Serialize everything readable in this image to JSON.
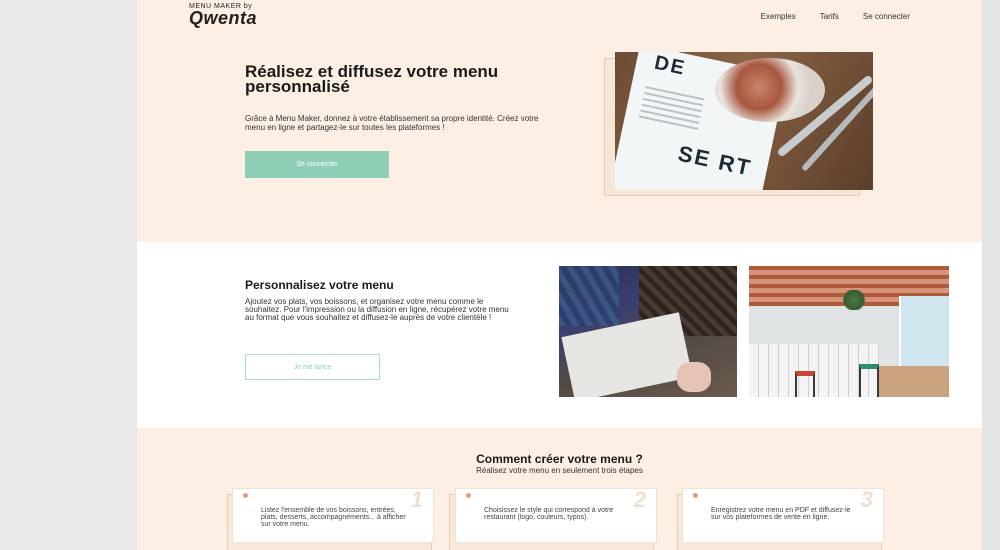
{
  "header": {
    "logo_small": "MENU MAKER by",
    "logo_big": "Qwenta",
    "nav": [
      "Exemples",
      "Tarifs",
      "Se connecter"
    ]
  },
  "hero": {
    "title": "Réalisez et diffusez votre menu personnalisé",
    "text": "Grâce à Menu Maker, donnez à votre établissement sa propre identité. Créez votre menu en ligne et partagez-le sur toutes les plateformes !",
    "button": "Se connecter",
    "photo_text_top": "DE",
    "photo_text_bottom": "SE RT"
  },
  "section2": {
    "title": "Personnalisez votre menu",
    "text": "Ajoutez vos plats, vos boissons, et organisez votre menu comme le souhaitez. Pour l'impression ou la diffusion en ligne, récupérez votre menu au format que vous souhaitez et diffusez-le auprès de votre clientèle !",
    "button": "Je me lance"
  },
  "steps": {
    "title": "Comment créer votre menu ?",
    "subtitle": "Réalisez votre menu en seulement trois étapes",
    "items": [
      {
        "num": "1",
        "text": "Listez l'ensemble de vos boissons, entrées, plats, desserts, accompagnements... à afficher sur votre menu."
      },
      {
        "num": "2",
        "text": "Choisissez le style qui correspond à votre restaurant (logo, couleurs, typos)."
      },
      {
        "num": "3",
        "text": "Enregistrez votre menu en PDF et diffusez-le sur vos plateformes de vente en ligne."
      }
    ]
  },
  "colors": {
    "page_bg": "#fdefe3",
    "accent": "#8ecfb6",
    "step_accent": "#d9a07e"
  }
}
